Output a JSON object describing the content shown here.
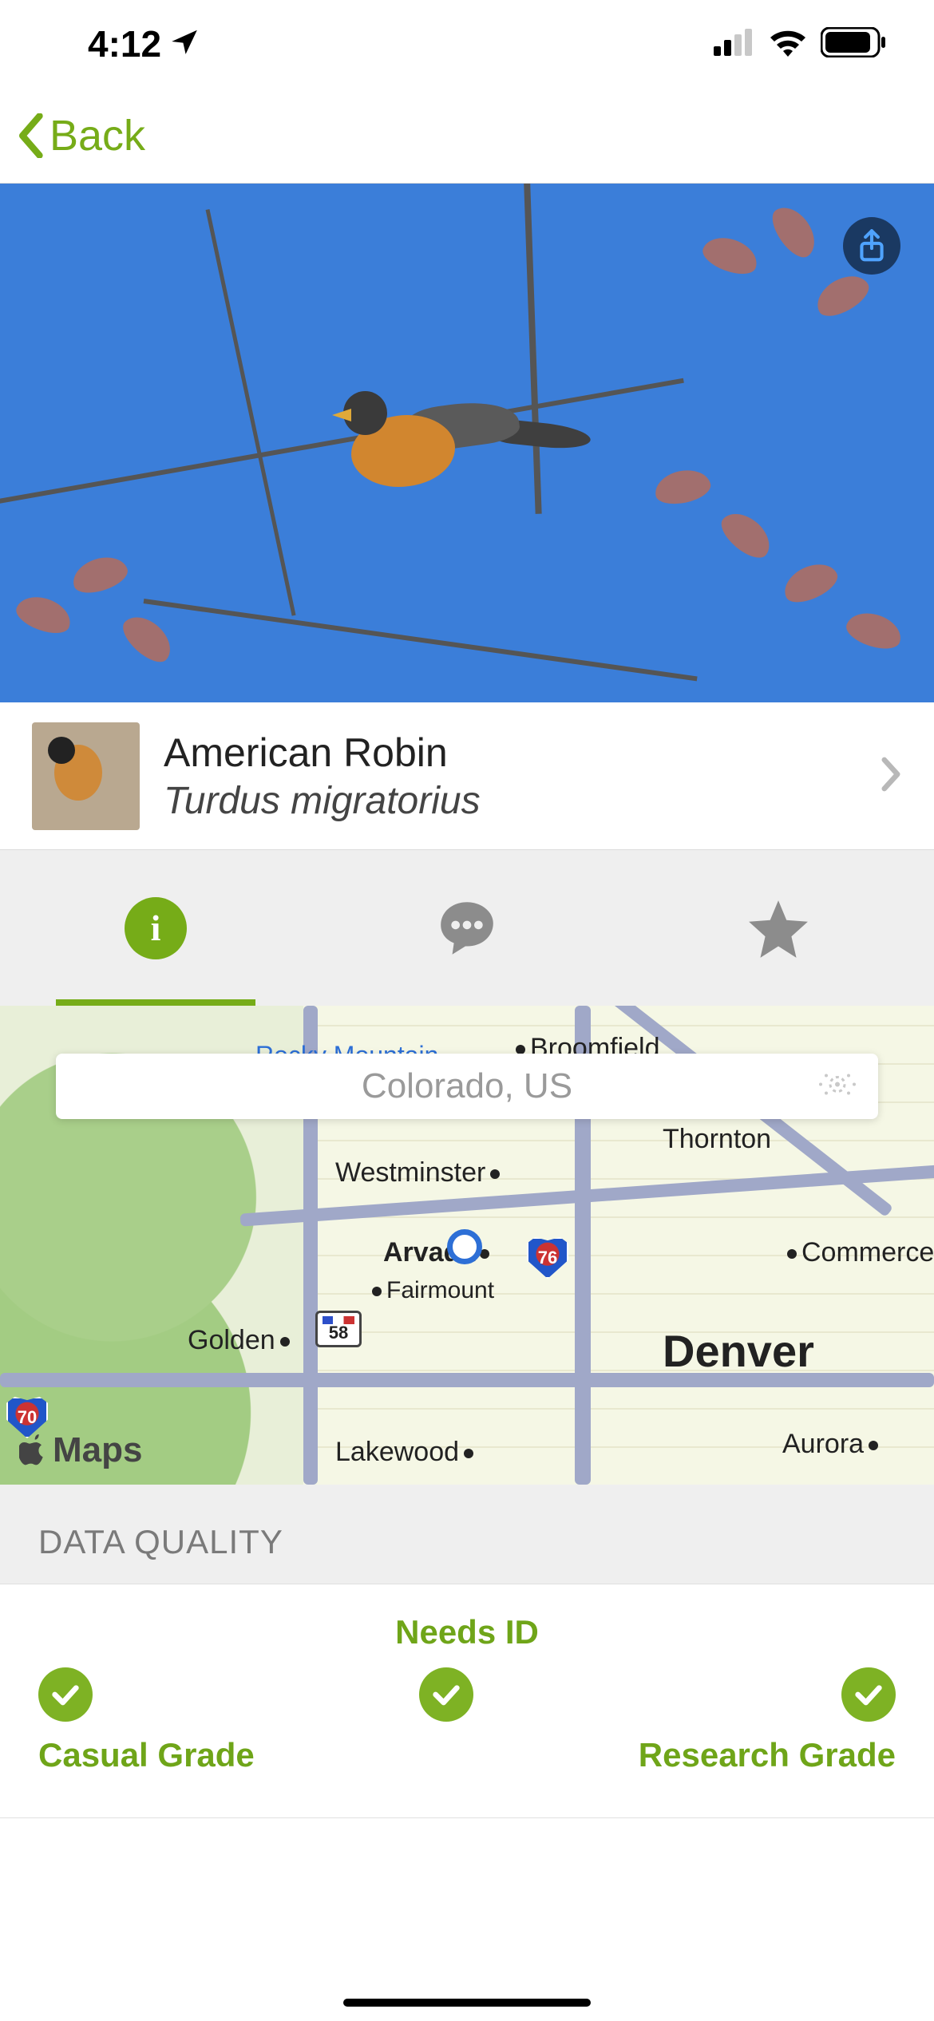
{
  "status": {
    "time": "4:12"
  },
  "nav": {
    "back_label": "Back"
  },
  "species": {
    "common_name": "American Robin",
    "scientific_name": "Turdus migratorius"
  },
  "location": {
    "display": "Colorado, US",
    "attribution": "Maps"
  },
  "map_labels": {
    "rocky_mountain": "Rocky Mountain",
    "broomfield": "Broomfield",
    "thornton": "Thornton",
    "westminster": "Westminster",
    "arvada": "Arvada",
    "fairmount": "Fairmount",
    "golden": "Golden",
    "commerce": "Commerce",
    "denver": "Denver",
    "lakewood": "Lakewood",
    "aurora": "Aurora",
    "hwy70": "70",
    "hwy76": "76",
    "hwy58": "58"
  },
  "data_quality": {
    "section_title": "DATA QUALITY",
    "needs_id": "Needs ID",
    "casual": "Casual Grade",
    "research": "Research Grade"
  }
}
